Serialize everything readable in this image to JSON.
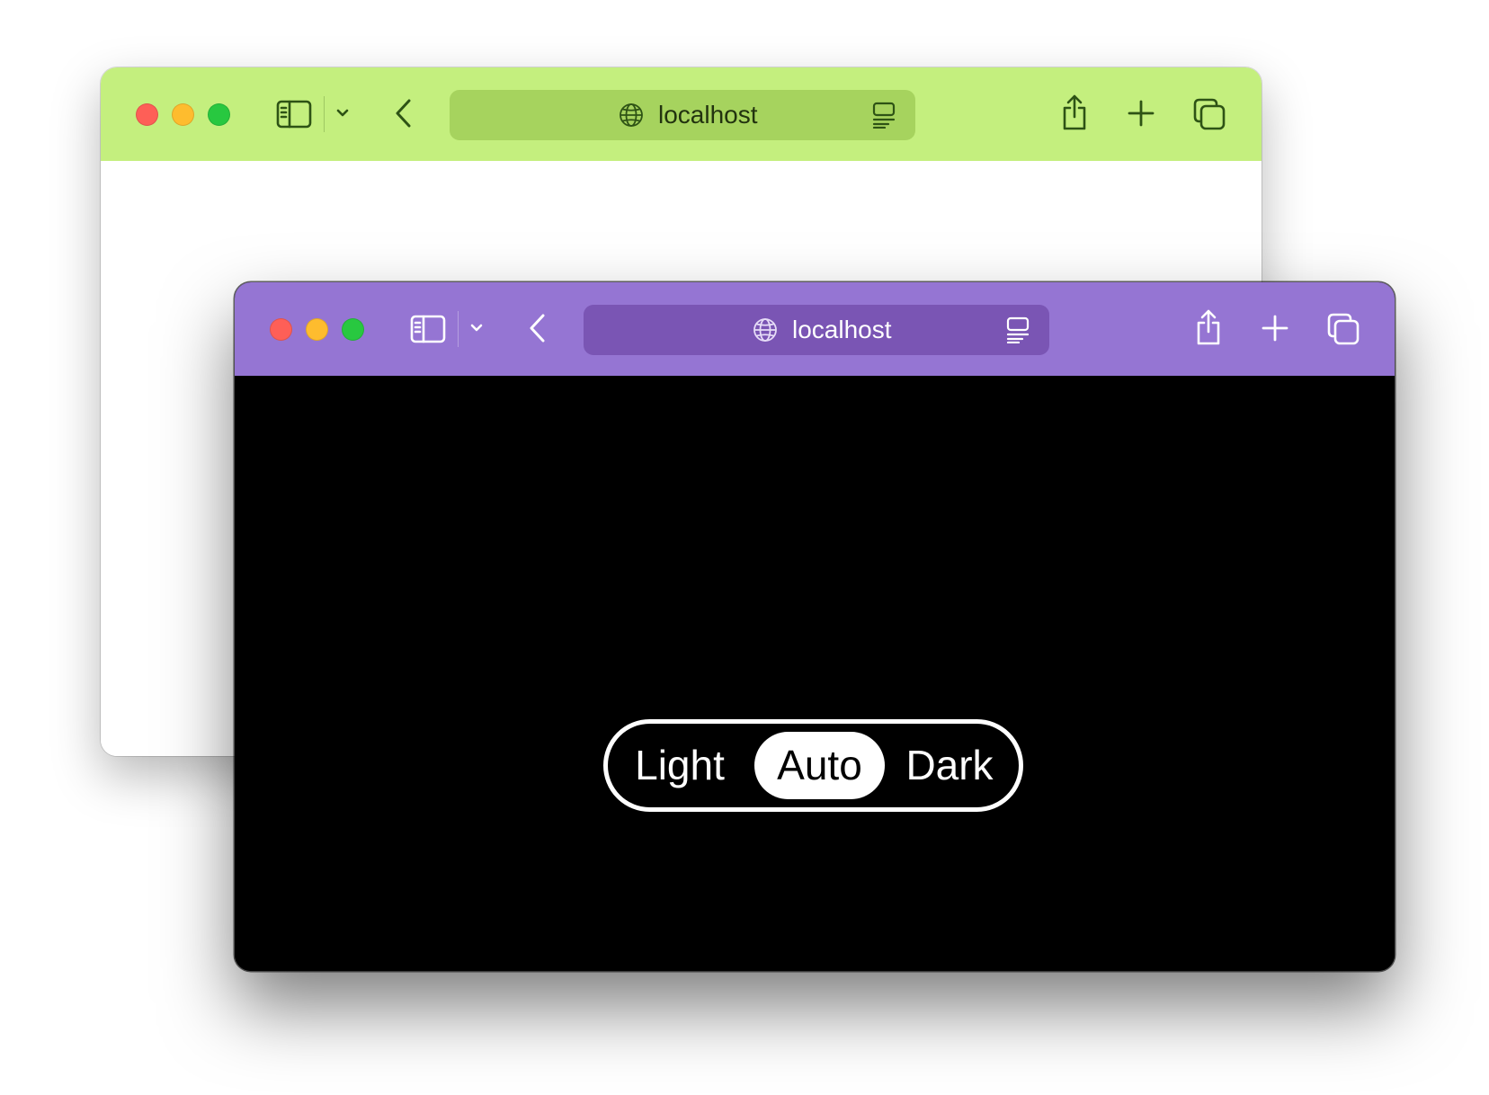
{
  "colors": {
    "back_toolbar": "#c4ef7e",
    "back_urlbar": "#a6d35e",
    "back_icon": "#2e5315",
    "back_text": "#22330f",
    "front_toolbar": "#9575d3",
    "front_urlbar": "#7a55b4",
    "front_icon": "#ffffff",
    "close": "#fe5f57",
    "minimize": "#febc2e",
    "maximize": "#28c840",
    "page_back": "#ffffff",
    "page_front": "#000000"
  },
  "back_window": {
    "url": "localhost",
    "icons": [
      "close-dot",
      "minimize-dot",
      "maximize-dot",
      "sidebar-icon",
      "chevron-down-icon",
      "back-arrow-icon",
      "globe-icon",
      "reader-icon",
      "share-icon",
      "plus-icon",
      "tabs-overview-icon"
    ]
  },
  "front_window": {
    "url": "localhost",
    "icons": [
      "close-dot",
      "minimize-dot",
      "maximize-dot",
      "sidebar-icon",
      "chevron-down-icon",
      "back-arrow-icon",
      "globe-icon",
      "reader-icon",
      "share-icon",
      "plus-icon",
      "tabs-overview-icon"
    ]
  },
  "theme_toggle": {
    "options": [
      "Light",
      "Auto",
      "Dark"
    ],
    "selected": "Auto"
  }
}
